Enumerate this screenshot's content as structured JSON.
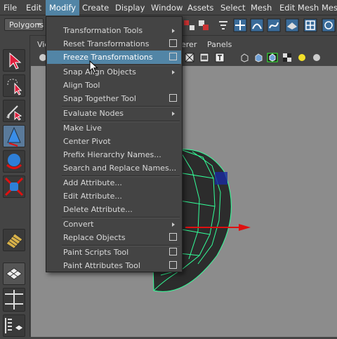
{
  "menubar": {
    "items": [
      "File",
      "Edit",
      "Modify",
      "Create",
      "Display",
      "Window",
      "Assets",
      "Select",
      "Mesh",
      "Edit Mesh",
      "Mesh"
    ]
  },
  "shelf": {
    "mode_select": "Polygons"
  },
  "viewport": {
    "tabs": [
      "Vie",
      "erer",
      "Panels"
    ]
  },
  "menu": {
    "items": [
      {
        "label": "Transformation Tools",
        "submenu": true,
        "option_box": false
      },
      {
        "label": "Reset Transformations",
        "submenu": false,
        "option_box": true
      },
      {
        "label": "Freeze Transformations",
        "submenu": false,
        "option_box": true,
        "highlighted": true
      },
      {
        "label": "Snap Align Objects",
        "submenu": true,
        "option_box": false
      },
      {
        "label": "Align Tool",
        "submenu": false,
        "option_box": false
      },
      {
        "label": "Snap Together Tool",
        "submenu": false,
        "option_box": true
      },
      {
        "label": "Evaluate Nodes",
        "submenu": true,
        "option_box": false
      },
      {
        "label": "Make Live",
        "submenu": false,
        "option_box": false
      },
      {
        "label": "Center Pivot",
        "submenu": false,
        "option_box": false
      },
      {
        "label": "Prefix Hierarchy Names...",
        "submenu": false,
        "option_box": false
      },
      {
        "label": "Search and Replace Names...",
        "submenu": false,
        "option_box": false
      },
      {
        "label": "Add Attribute...",
        "submenu": false,
        "option_box": false
      },
      {
        "label": "Edit Attribute...",
        "submenu": false,
        "option_box": false
      },
      {
        "label": "Delete Attribute...",
        "submenu": false,
        "option_box": false
      },
      {
        "label": "Convert",
        "submenu": true,
        "option_box": false
      },
      {
        "label": "Replace Objects",
        "submenu": false,
        "option_box": true
      },
      {
        "label": "Paint Scripts Tool",
        "submenu": false,
        "option_box": true
      },
      {
        "label": "Paint Attributes Tool",
        "submenu": false,
        "option_box": true
      }
    ]
  },
  "colors": {
    "highlight": "#5285a6",
    "wireframe": "#33ff99",
    "axis": "#e01010",
    "viewport_bg": "#8c8c8c"
  },
  "icons": [
    "select-arrow-icon",
    "lasso-icon",
    "paint-select-icon",
    "move-icon",
    "rotate-icon",
    "scale-icon",
    "snap-grid-icon",
    "layout-icon"
  ]
}
